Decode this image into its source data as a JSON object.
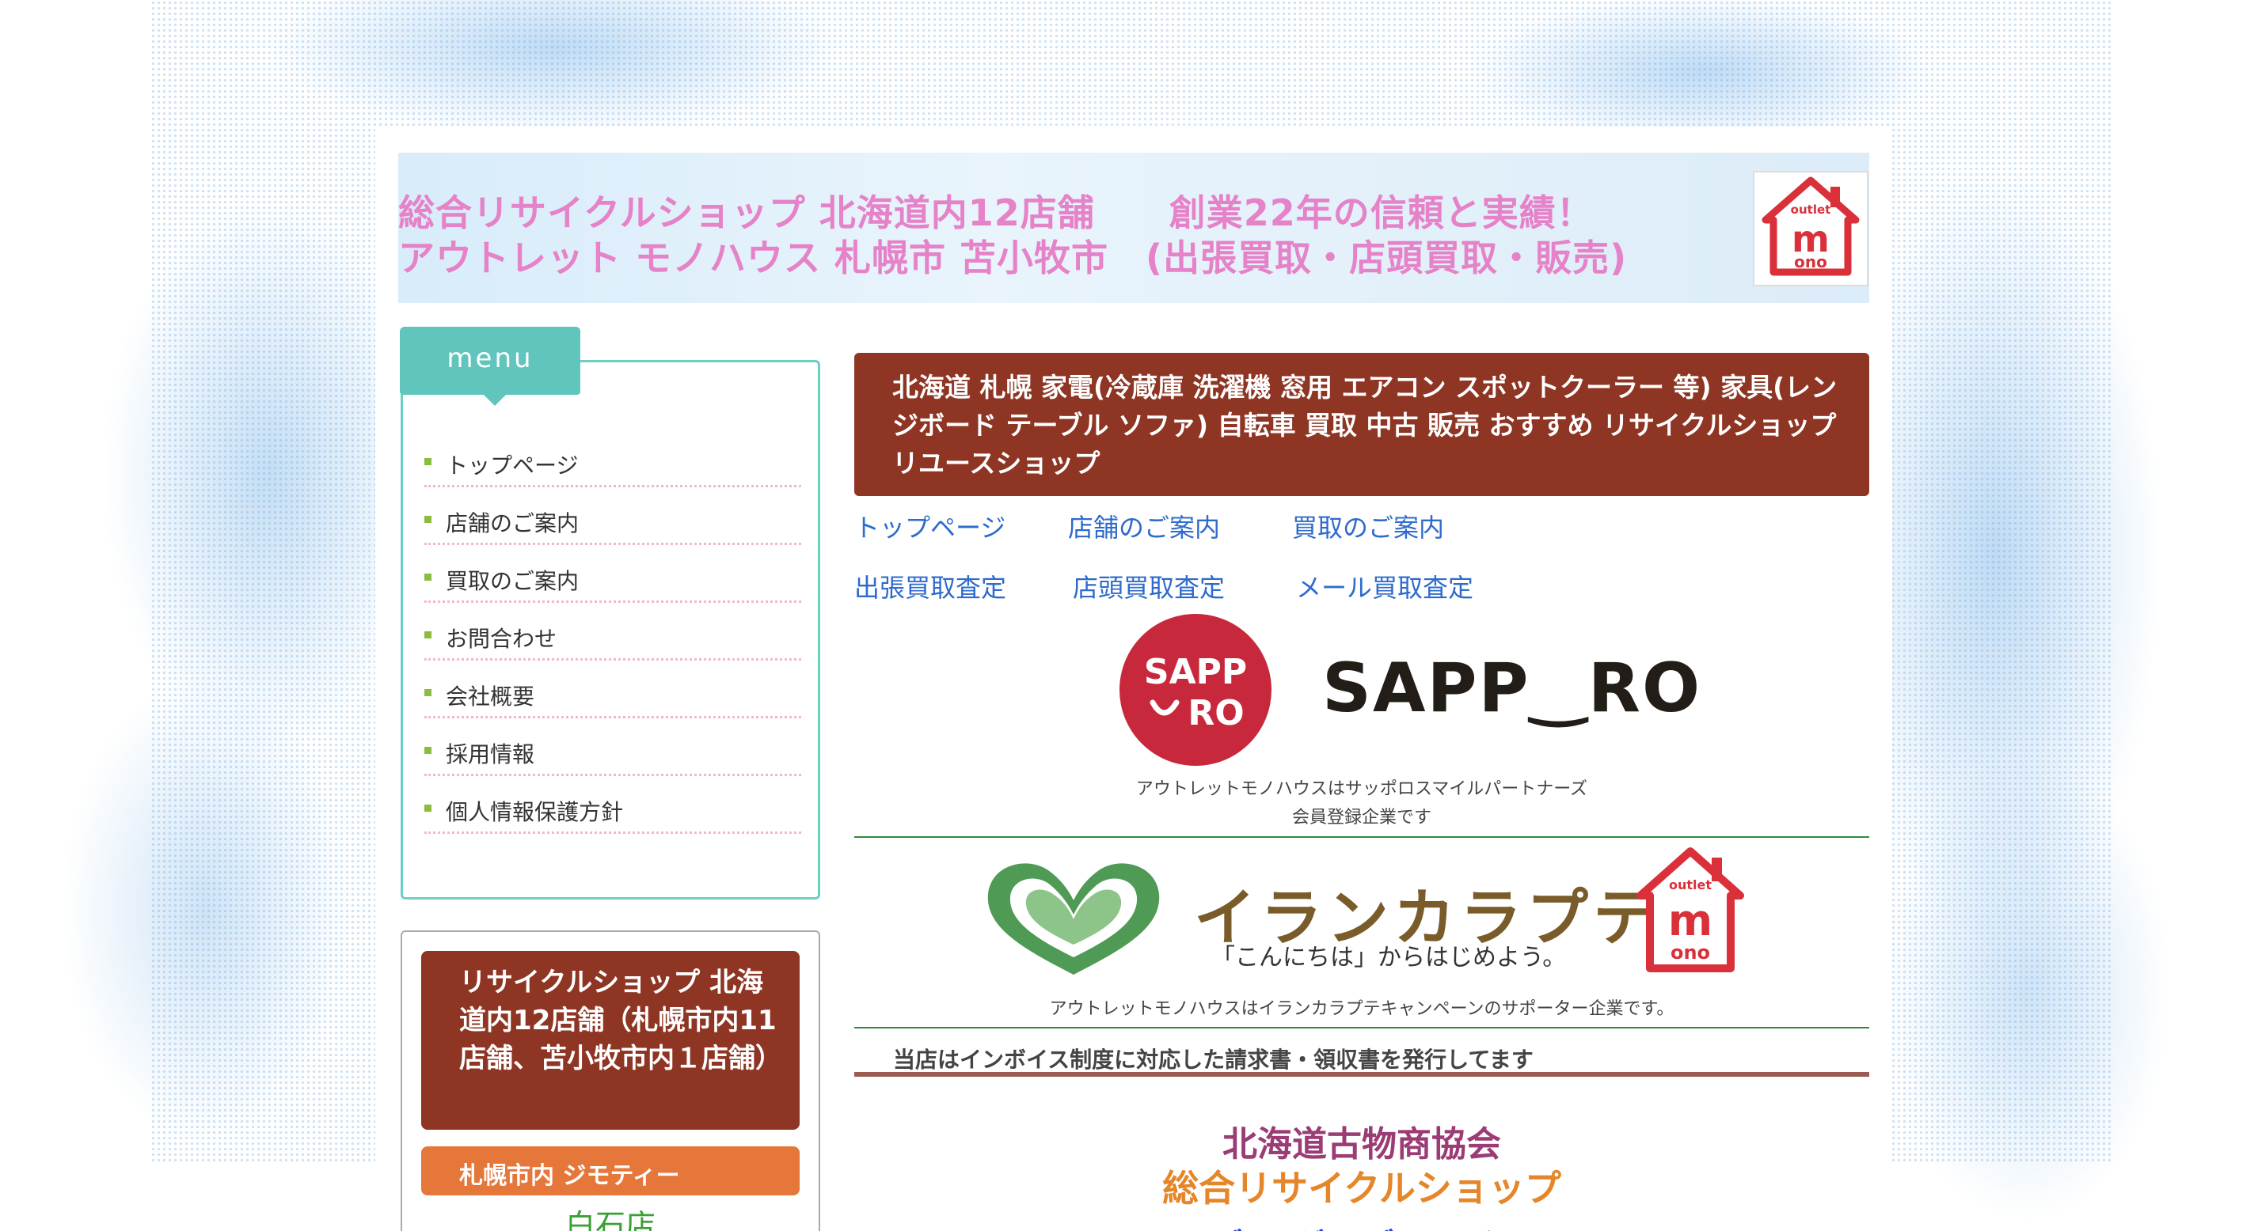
{
  "header": {
    "line1": "総合リサイクルショップ 北海道内12店舗　　創業22年の信頼と実績！",
    "line2": "アウトレット モノハウス 札幌市 苫小牧市　(出張買取・店頭買取・販売)",
    "logo_text_top": "outlet",
    "logo_text_main": "mono"
  },
  "menu": {
    "title": "menu",
    "items": [
      {
        "label": "トップページ"
      },
      {
        "label": "店舗のご案内"
      },
      {
        "label": "買取のご案内"
      },
      {
        "label": "お問合わせ"
      },
      {
        "label": "会社概要"
      },
      {
        "label": "採用情報"
      },
      {
        "label": "個人情報保護方針"
      }
    ]
  },
  "sidebar": {
    "shops_title": "リサイクルショップ 北海道内12店舗（札幌市内11店舗、苫小牧市内１店舗）",
    "jmty_label": "札幌市内 ジモティー",
    "first_shop": "白石店"
  },
  "main": {
    "title": "北海道 札幌 家電(冷蔵庫 洗濯機 窓用 エアコン スポットクーラー 等) 家具(レンジボード テーブル ソファ) 自転車 買取 中古 販売 おすすめ リサイクルショップ リユースショップ",
    "nav_row1": [
      "トップページ",
      "店舗のご案内",
      "買取のご案内"
    ],
    "nav_row2": [
      "出張買取査定",
      "店頭買取査定",
      "メール買取査定"
    ],
    "sapporo_badge_top": "SAPP",
    "sapporo_badge_bottom": "RO",
    "sapporo_wordmark": "SAPP‿RO",
    "sapporo_caption_1": "アウトレットモノハウスはサッポロスマイルパートナーズ",
    "sapporo_caption_2": "会員登録企業です",
    "irankarapte_title": "イランカラプテ",
    "irankarapte_sub": "「こんにちは」からはじめよう。",
    "irankarapte_caption": "アウトレットモノハウスはイランカラプテキャンペーンのサポーター企業です。",
    "invoice_notice": "当店はインボイス制度に対応した請求書・領収書を発行してます",
    "assoc_line1": "北海道古物商協会",
    "assoc_line2": "総合リサイクルショップ",
    "assoc_line3": "ユーズド グッズ マーケット"
  },
  "colors": {
    "header_text": "#e582c8",
    "menu_accent": "#5fc5bd",
    "title_box": "#8e3524",
    "link": "#2e6bcc",
    "sapporo_red": "#c8283c",
    "jmty_orange": "#e5773a"
  }
}
